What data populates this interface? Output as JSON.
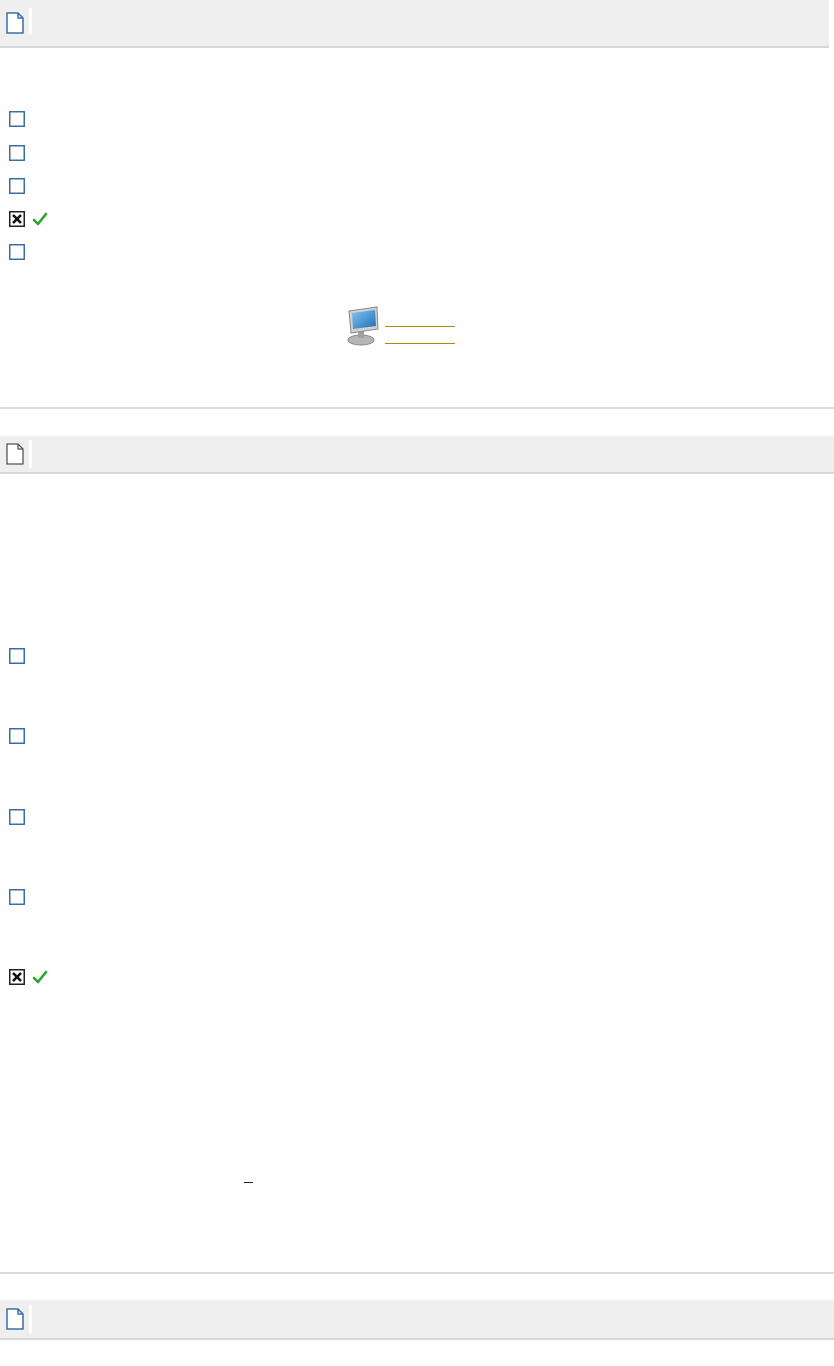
{
  "colors": {
    "header_bg": "#efefef",
    "header_border": "#d8d8d8",
    "divider": "#dcdcdc",
    "box_border": "#3a6ea5",
    "correct_green": "#2aa52a",
    "link": "#b8860b"
  },
  "icons": {
    "header": "document-icon",
    "unchecked": "checkbox-empty-icon",
    "checked": "checkbox-x-icon",
    "correct": "checkmark-icon",
    "nav": "computer-monitor-icon"
  },
  "questions": [
    {
      "options": [
        {
          "checked": false,
          "correct": false
        },
        {
          "checked": false,
          "correct": false
        },
        {
          "checked": false,
          "correct": false
        },
        {
          "checked": true,
          "correct": true
        },
        {
          "checked": false,
          "correct": false
        }
      ],
      "nav_links": [
        "",
        ""
      ]
    },
    {
      "options": [
        {
          "checked": false,
          "correct": false
        },
        {
          "checked": false,
          "correct": false
        },
        {
          "checked": false,
          "correct": false
        },
        {
          "checked": false,
          "correct": false
        },
        {
          "checked": true,
          "correct": true
        }
      ]
    },
    {
      "options": []
    }
  ]
}
